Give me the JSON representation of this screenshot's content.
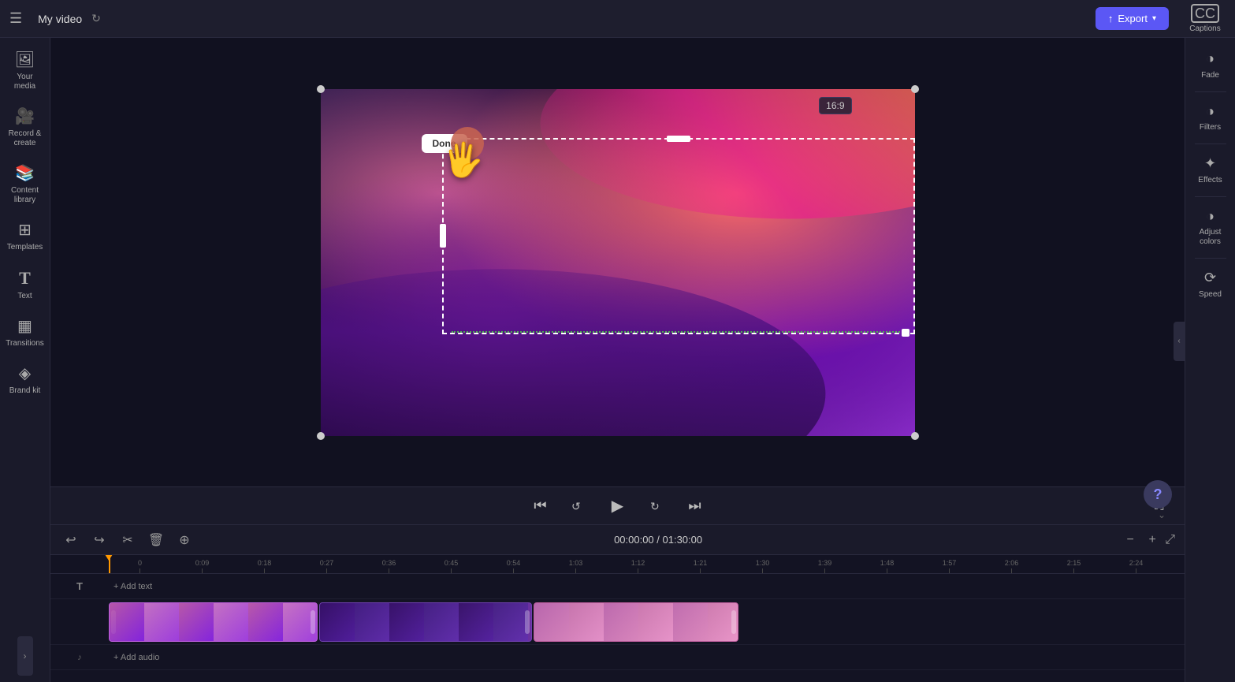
{
  "topbar": {
    "title": "My video",
    "export_label": "Export",
    "captions_label": "Captions"
  },
  "left_sidebar": {
    "items": [
      {
        "id": "your-media",
        "icon": "🖼",
        "label": "Your media"
      },
      {
        "id": "record-create",
        "icon": "🎥",
        "label": "Record &\ncreate"
      },
      {
        "id": "content-library",
        "icon": "📚",
        "label": "Content\nlibrary"
      },
      {
        "id": "templates",
        "icon": "⊞",
        "label": "Templates"
      },
      {
        "id": "text",
        "icon": "T",
        "label": "Text"
      },
      {
        "id": "transitions",
        "icon": "▦",
        "label": "Transitions"
      },
      {
        "id": "brand-kit",
        "icon": "◈",
        "label": "Brand kit"
      }
    ]
  },
  "right_panel": {
    "items": [
      {
        "id": "fade",
        "icon": "◑",
        "label": "Fade"
      },
      {
        "id": "filters",
        "icon": "◑",
        "label": "Filters"
      },
      {
        "id": "effects",
        "icon": "✦",
        "label": "Effects"
      },
      {
        "id": "adjust-colors",
        "icon": "◑",
        "label": "Adjust\ncolors"
      },
      {
        "id": "speed",
        "icon": "⟳",
        "label": "Speed"
      }
    ]
  },
  "preview": {
    "aspect_ratio": "16:9",
    "done_label": "Done",
    "crop_visible": true
  },
  "playback": {
    "skip_back_label": "⏮",
    "rewind_label": "⏪",
    "play_label": "▶",
    "forward_label": "⏩",
    "skip_forward_label": "⏭",
    "fullscreen_label": "⛶"
  },
  "timeline": {
    "current_time": "00:00:00",
    "total_time": "01:30:00",
    "time_display": "00:00:00 / 01:30:00",
    "add_text_label": "+ Add text",
    "add_audio_label": "+ Add audio",
    "ruler_marks": [
      "0:09",
      "0:18",
      "0:27",
      "0:36",
      "0:45",
      "0:54",
      "1:03",
      "1:12",
      "1:21",
      "1:30",
      "1:39",
      "1:48",
      "1:57",
      "2:06",
      "2:15",
      "2:24"
    ]
  }
}
